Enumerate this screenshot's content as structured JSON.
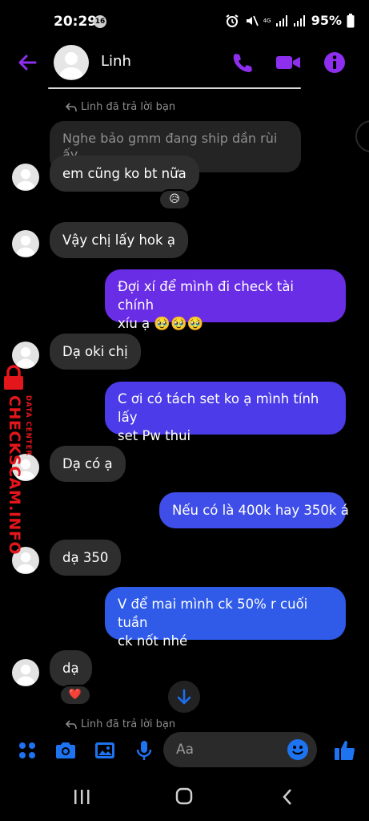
{
  "status_bar": {
    "time": "20:29",
    "badge": "16",
    "network": "4G",
    "battery": "95%"
  },
  "header": {
    "contact_name": "Linh"
  },
  "conversation": {
    "reply_note_top": "Linh đã trả lời bạn",
    "quoted_text": "Nghe bảo gmm đang ship dần rùi ấy",
    "messages": [
      {
        "text": "em cũng ko bt nữa",
        "reaction": "😥"
      },
      {
        "text": "Vậy chị lấy hok ạ"
      },
      {
        "line1": "Đợi xí để mình đi check tài chính",
        "line2": "xíu ạ 🥹🥹🥹"
      },
      {
        "text": "Dạ oki chị"
      },
      {
        "line1": "C ơi có tách set ko ạ mình tính lấy",
        "line2": "set Pw thui"
      },
      {
        "text": "Dạ có ạ"
      },
      {
        "text": "Nếu có là 400k hay 350k á"
      },
      {
        "text": "dạ 350"
      },
      {
        "line1": "V để mai mình ck 50% r cuối tuần",
        "line2": "ck nốt nhé"
      },
      {
        "text": "dạ",
        "reaction": "❤️"
      }
    ],
    "reply_note_bottom": "Linh đã trả lời bạn"
  },
  "watermark": {
    "main": "CHECKSCAM.INFO",
    "sub": "DATA CENTER"
  },
  "composer": {
    "placeholder": "Aa"
  },
  "colors": {
    "accent": "#8e2ff0",
    "bubble_in": "#2e2e2e",
    "bubble_out_purple": "#6a2de6",
    "bubble_out_blue": "#2f5be8",
    "watermark": "#e3161b"
  }
}
